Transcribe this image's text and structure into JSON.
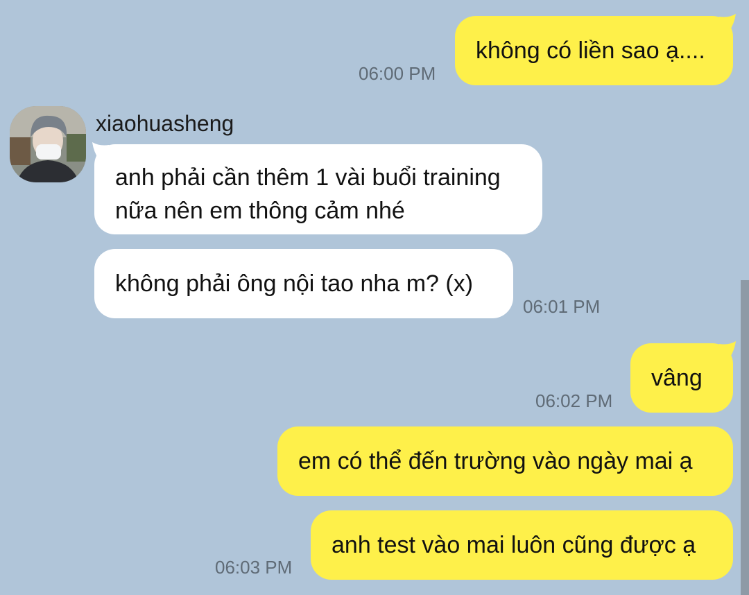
{
  "chat": {
    "contact_name": "xiaohuasheng",
    "messages": [
      {
        "side": "out",
        "text": "không có liền sao ạ....",
        "time": "06:00 PM"
      },
      {
        "side": "in",
        "text": "anh phải cần thêm 1 vài buổi training nữa nên em thông cảm nhé",
        "time": ""
      },
      {
        "side": "in",
        "text": "không phải ông nội tao nha m? (x)",
        "time": "06:01 PM"
      },
      {
        "side": "out",
        "text": "vâng",
        "time": "06:02 PM"
      },
      {
        "side": "out",
        "text": "em có thể đến trường vào ngày mai ạ",
        "time": ""
      },
      {
        "side": "out",
        "text": "anh test vào mai luôn cũng được ạ",
        "time": "06:03 PM"
      }
    ]
  },
  "colors": {
    "background": "#b0c5d9",
    "outgoing_bubble": "#fef04a",
    "incoming_bubble": "#ffffff",
    "timestamp": "#5f6b76"
  }
}
